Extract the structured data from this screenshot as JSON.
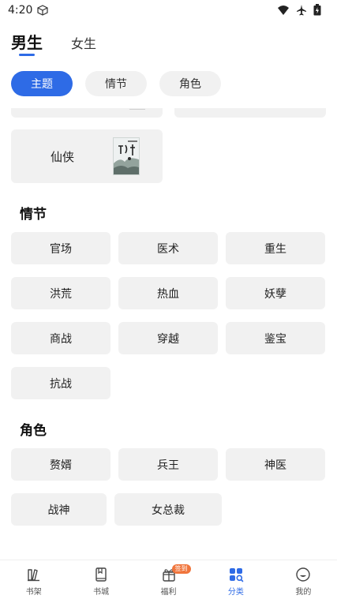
{
  "status": {
    "time": "4:20"
  },
  "gender_tabs": [
    {
      "label": "男生"
    },
    {
      "label": "女生"
    }
  ],
  "filter_chips": [
    {
      "label": "主题"
    },
    {
      "label": "情节"
    },
    {
      "label": "角色"
    }
  ],
  "theme_card": {
    "label": "仙侠"
  },
  "plot_section": {
    "title": "情节",
    "items": [
      "官场",
      "医术",
      "重生",
      "洪荒",
      "热血",
      "妖孽",
      "商战",
      "穿越",
      "鉴宝",
      "抗战"
    ]
  },
  "role_section": {
    "title": "角色",
    "items": [
      "赘婿",
      "兵王",
      "神医",
      "战神",
      "女总裁"
    ]
  },
  "bottom_nav": [
    {
      "label": "书架",
      "icon": "bookshelf-icon"
    },
    {
      "label": "书城",
      "icon": "book-icon"
    },
    {
      "label": "福利",
      "icon": "gift-icon",
      "badge": "签到"
    },
    {
      "label": "分类",
      "icon": "category-icon"
    },
    {
      "label": "我的",
      "icon": "profile-icon"
    }
  ],
  "colors": {
    "accent": "#2e6be6",
    "chip_bg": "#f1f1f1",
    "badge": "#f0753c"
  }
}
